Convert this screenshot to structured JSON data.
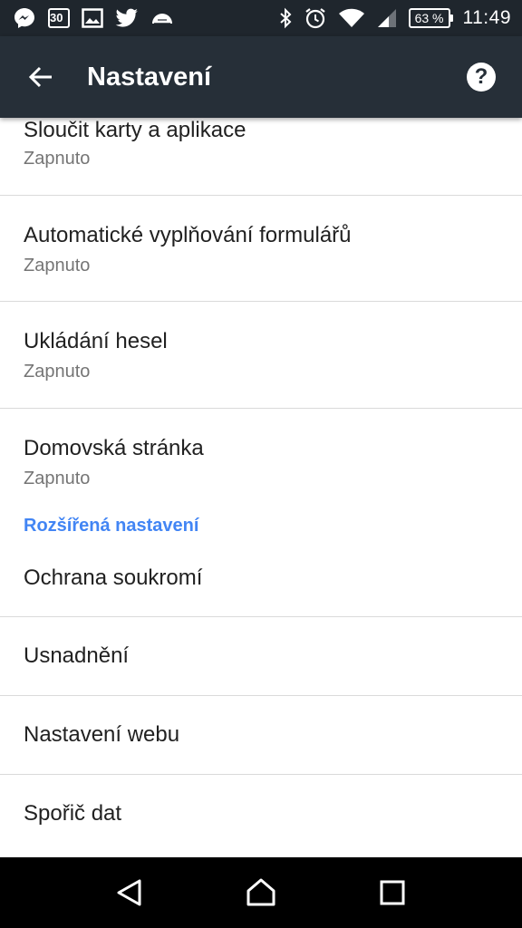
{
  "status_bar": {
    "icons_left": [
      "messenger-icon",
      "calendar-icon",
      "image-icon",
      "twitter-icon",
      "weather-icon"
    ],
    "date_number": "30",
    "icons_right": [
      "bluetooth-icon",
      "alarm-icon",
      "wifi-icon",
      "signal-icon",
      "battery-icon"
    ],
    "battery": "63 %",
    "time": "11:49"
  },
  "app_bar": {
    "title": "Nastavení",
    "back_icon": "arrow-left-icon",
    "help_icon": "help-icon",
    "help_glyph": "?"
  },
  "settings": {
    "items": [
      {
        "title": "Sloučit karty a aplikace",
        "subtitle": "Zapnuto"
      },
      {
        "title": "Automatické vyplňování formulářů",
        "subtitle": "Zapnuto"
      },
      {
        "title": "Ukládání hesel",
        "subtitle": "Zapnuto"
      },
      {
        "title": "Domovská stránka",
        "subtitle": "Zapnuto"
      }
    ],
    "advanced_header": "Rozšířená nastavení",
    "advanced_items": [
      {
        "title": "Ochrana soukromí"
      },
      {
        "title": "Usnadnění"
      },
      {
        "title": "Nastavení webu"
      },
      {
        "title": "Spořič dat"
      }
    ]
  },
  "nav_bar": {
    "back_icon": "nav-back-icon",
    "home_icon": "nav-home-icon",
    "recents_icon": "nav-recents-icon"
  },
  "colors": {
    "status_bar": "#1f262d",
    "app_bar": "#262f38",
    "accent": "#4285f4",
    "subtitle": "#757575"
  }
}
